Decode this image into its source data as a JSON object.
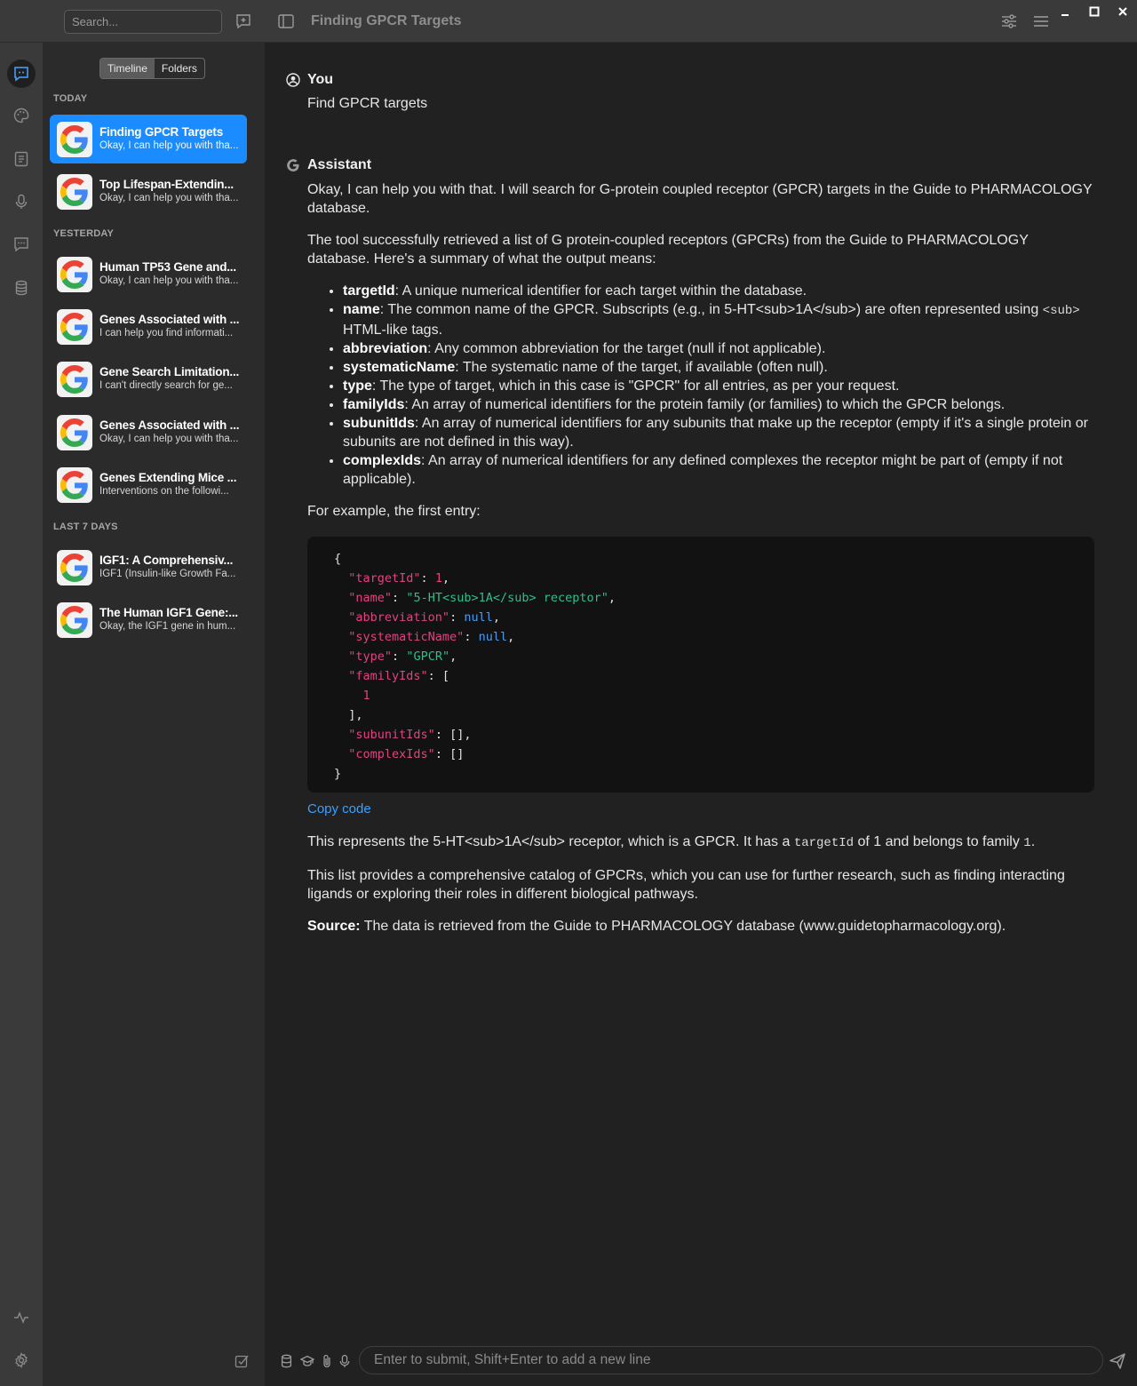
{
  "titlebar": {
    "search_placeholder": "Search...",
    "title": "Finding GPCR Targets",
    "icons": [
      "new-chat-icon",
      "sidebar-toggle-icon",
      "sliders-icon",
      "menu-icon",
      "minimize-icon",
      "maximize-icon",
      "close-icon"
    ]
  },
  "rail": {
    "items": [
      "chat-icon",
      "palette-icon",
      "notes-icon",
      "microphone-icon",
      "message-icon",
      "database-icon"
    ],
    "bottom": [
      "activity-icon",
      "settings-icon"
    ]
  },
  "sidebar": {
    "tabs": {
      "timeline": "Timeline",
      "folders": "Folders"
    },
    "groups": {
      "today": "TODAY",
      "yesterday": "YESTERDAY",
      "last7": "LAST 7 DAYS"
    },
    "chats": [
      {
        "title": "Finding GPCR Targets",
        "snippet": "Okay, I can help you with tha...",
        "selected": true
      },
      {
        "title": "Top Lifespan-Extendin...",
        "snippet": "Okay, I can help you with tha..."
      },
      {
        "title": "Human TP53 Gene and...",
        "snippet": "Okay, I can help you with tha..."
      },
      {
        "title": "Genes Associated with ...",
        "snippet": "I can help you find informati..."
      },
      {
        "title": "Gene Search Limitation...",
        "snippet": "I can't directly search for ge..."
      },
      {
        "title": "Genes Associated with ...",
        "snippet": "Okay, I can help you with tha..."
      },
      {
        "title": "Genes Extending Mice ...",
        "snippet": "Interventions on the followi..."
      },
      {
        "title": "IGF1: A Comprehensiv...",
        "snippet": "IGF1 (Insulin-like Growth Fa..."
      },
      {
        "title": "The Human IGF1 Gene:...",
        "snippet": "Okay, the IGF1 gene in hum..."
      }
    ]
  },
  "conversation": {
    "user_label": "You",
    "user_message": "Find GPCR targets",
    "assistant_label": "Assistant",
    "p1": "Okay, I can help you with that. I will search for G-protein coupled receptor (GPCR) targets in the Guide to PHARMACOLOGY database.",
    "p2": "The tool successfully retrieved a list of G protein-coupled receptors (GPCRs) from the Guide to PHARMACOLOGY database. Here's a summary of what the output means:",
    "bullets": [
      {
        "term": "targetId",
        "text": ": A unique numerical identifier for each target within the database."
      },
      {
        "term": "name",
        "text": ": The common name of the GPCR. Subscripts (e.g., in 5-HT<sub>1A</sub>) are often represented using ",
        "code": "<sub>",
        "text2": " HTML-like tags."
      },
      {
        "term": "abbreviation",
        "text": ": Any common abbreviation for the target (null if not applicable)."
      },
      {
        "term": "systematicName",
        "text": ": The systematic name of the target, if available (often null)."
      },
      {
        "term": "type",
        "text": ": The type of target, which in this case is \"GPCR\" for all entries, as per your request."
      },
      {
        "term": "familyIds",
        "text": ": An array of numerical identifiers for the protein family (or families) to which the GPCR belongs."
      },
      {
        "term": "subunitIds",
        "text": ": An array of numerical identifiers for any subunits that make up the receptor (empty if it's a single protein or subunits are not defined in this way)."
      },
      {
        "term": "complexIds",
        "text": ": An array of numerical identifiers for any defined complexes the receptor might be part of (empty if not applicable)."
      }
    ],
    "example_intro": "For example, the first entry:",
    "code": {
      "open": "{",
      "close": "}",
      "k_targetId": "\"targetId\"",
      "v_targetId": "1",
      "k_name": "\"name\"",
      "v_name": "\"5-HT<sub>1A</sub> receptor\"",
      "k_abbreviation": "\"abbreviation\"",
      "v_abbreviation": "null",
      "k_systematicName": "\"systematicName\"",
      "v_systematicName": "null",
      "k_type": "\"type\"",
      "v_type": "\"GPCR\"",
      "k_familyIds": "\"familyIds\"",
      "v_familyIds_item": "1",
      "k_subunitIds": "\"subunitIds\"",
      "k_complexIds": "\"complexIds\""
    },
    "copy_label": "Copy code",
    "p3_a": "This represents the 5-HT<sub>1A</sub> receptor, which is a GPCR. It has a ",
    "p3_code": "targetId",
    "p3_b": " of 1 and belongs to family ",
    "p3_code2": "1",
    "p3_c": ".",
    "p4": "This list provides a comprehensive catalog of GPCRs, which you can use for further research, such as finding interacting ligands or exploring their roles in different biological pathways.",
    "source_label": "Source:",
    "source_text": " The data is retrieved from the Guide to PHARMACOLOGY database (www.guidetopharmacology.org)."
  },
  "composer": {
    "placeholder": "Enter to submit, Shift+Enter to add a new line"
  },
  "colors": {
    "accent": "#1a8cff",
    "link": "#3aa0ff",
    "code_key": "#e0447f",
    "code_string": "#2fbf8e",
    "code_null": "#4a9cf0"
  }
}
